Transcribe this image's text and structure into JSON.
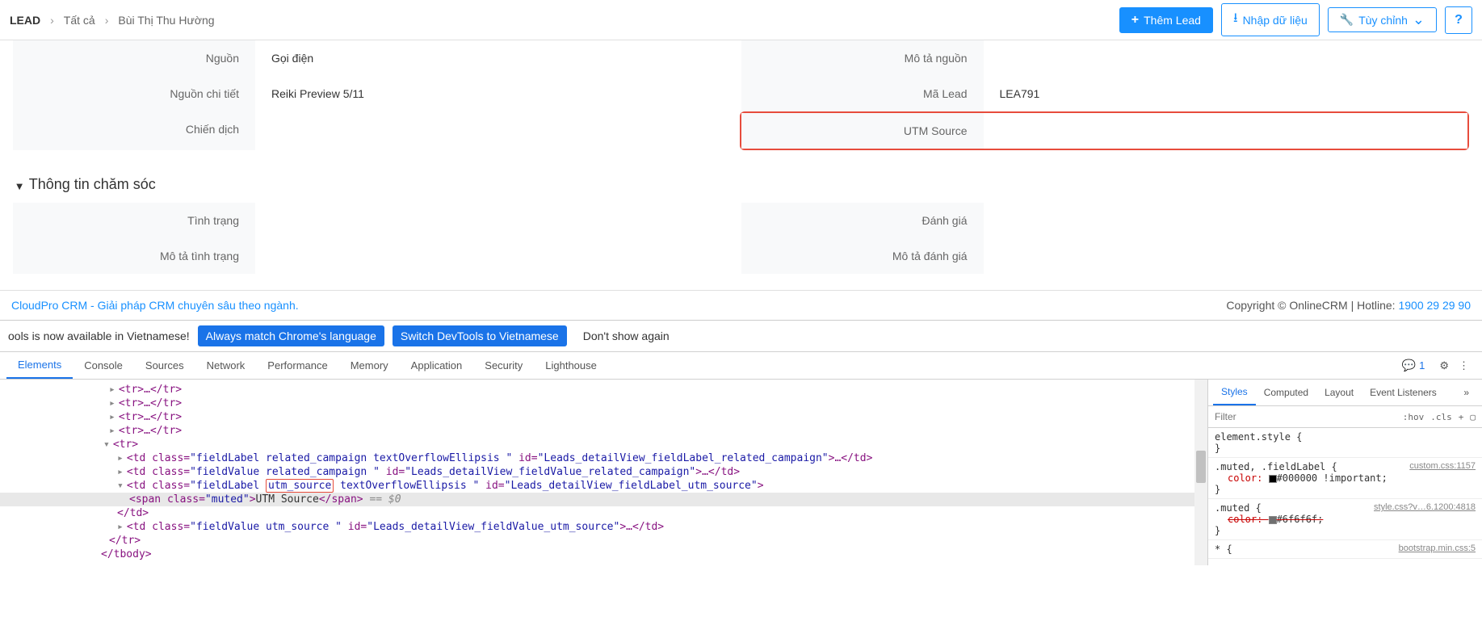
{
  "breadcrumb": {
    "root": "LEAD",
    "all": "Tất cả",
    "name": "Bùi Thị Thu Hường",
    "sep": "›"
  },
  "actions": {
    "add_lead": "Thêm Lead",
    "import": "Nhập dữ liệu",
    "customize": "Tùy chỉnh"
  },
  "fields": {
    "source_label": "Nguồn",
    "source_value": "Gọi điện",
    "source_detail_label": "Nguồn chi tiết",
    "source_detail_value": "Reiki Preview 5/11",
    "campaign_label": "Chiến dịch",
    "campaign_value": "",
    "source_desc_label": "Mô tả nguồn",
    "source_desc_value": "",
    "lead_code_label": "Mã Lead",
    "lead_code_value": "LEA791",
    "utm_source_label": "UTM Source",
    "utm_source_value": ""
  },
  "section2": {
    "title": "Thông tin chăm sóc",
    "status_label": "Tình trạng",
    "rating_label": "Đánh giá",
    "status_desc_label": "Mô tả tình trạng",
    "rating_desc_label": "Mô tả đánh giá"
  },
  "footer": {
    "brand": "CloudPro CRM - Giải pháp CRM chuyên sâu theo ngành.",
    "copyright": "Copyright © OnlineCRM | Hotline: ",
    "hotline": "1900 29 29 90"
  },
  "devtools": {
    "banner": {
      "msg": "ools is now available in Vietnamese!",
      "btn1": "Always match Chrome's language",
      "btn2": "Switch DevTools to Vietnamese",
      "btn3": "Don't show again"
    },
    "tabs": {
      "elements": "Elements",
      "console": "Console",
      "sources": "Sources",
      "network": "Network",
      "performance": "Performance",
      "memory": "Memory",
      "application": "Application",
      "security": "Security",
      "lighthouse": "Lighthouse",
      "badge": "1"
    },
    "dom": {
      "tr_short": "<tr>…</tr>",
      "tr_open": "<tr>",
      "td1_open": "<td class=\"fieldLabel related_campaign textOverflowEllipsis \" id=\"Leads_detailView_fieldLabel_related_campaign\">",
      "td1_close": "…</td>",
      "td2": "<td class=\"fieldValue related_campaign \" id=\"Leads_detailView_fieldValue_related_campaign\">…</td>",
      "td3_a": "<td class=\"fieldLabel ",
      "td3_box": "utm_source",
      "td3_b": " textOverflowEllipsis \" id=\"Leads_detailView_fieldLabel_utm_source\">",
      "span_open": "<span class=\"muted\">",
      "span_text": "UTM Source",
      "span_close": "</span>",
      "eq0": " == $0",
      "td_close": "</td>",
      "td4": "<td class=\"fieldValue utm_source \" id=\"Leads_detailView_fieldValue_utm_source\">…</td>",
      "tr_close": "</tr>",
      "tbody_close": "</tbody>"
    },
    "side": {
      "styles": "Styles",
      "computed": "Computed",
      "layout": "Layout",
      "event": "Event Listeners",
      "filter_placeholder": "Filter",
      "hov": ":hov",
      "cls": ".cls",
      "plus": "+",
      "box": "▢",
      "rule1_sel": "element.style {",
      "rule1_close": "}",
      "rule2_sel": ".muted, .fieldLabel {",
      "rule2_link": "custom.css:1157",
      "rule2_prop": "color",
      "rule2_val": "#000000 !important;",
      "rule3_sel": ".muted {",
      "rule3_link": "style.css?v…6.1200:4818",
      "rule3_prop": "color",
      "rule3_val": "#6f6f6f;",
      "rule4_sel": "* {",
      "rule4_link": "bootstrap.min.css:5"
    }
  }
}
